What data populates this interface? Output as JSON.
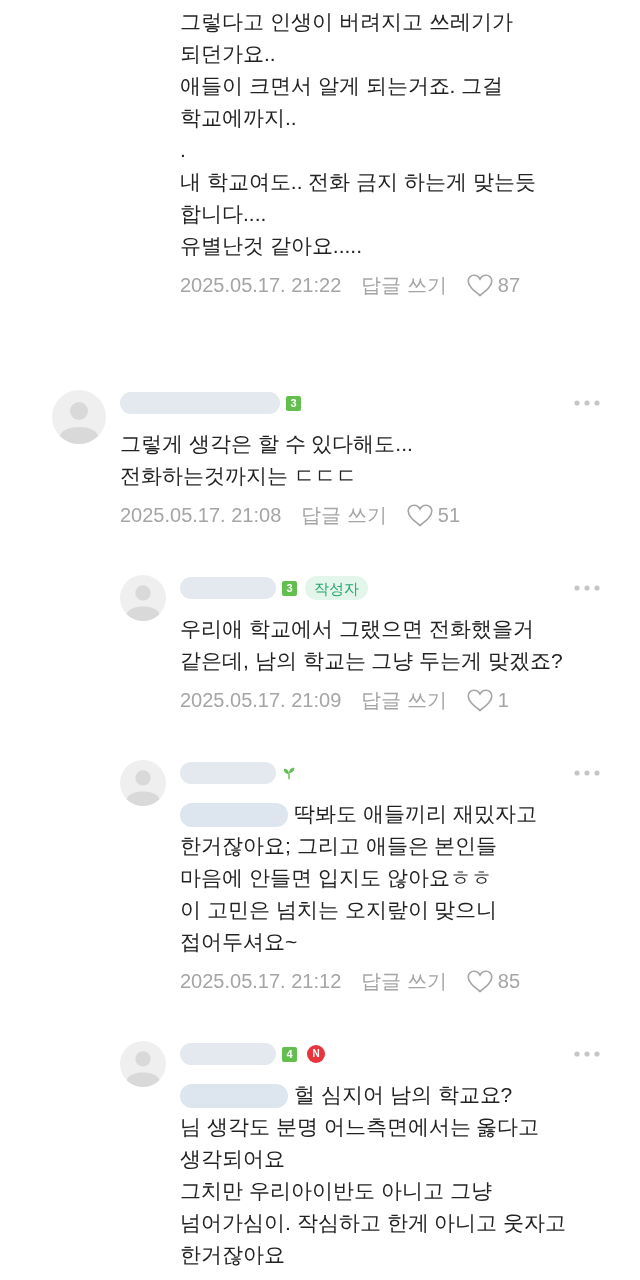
{
  "comments": [
    {
      "replies": [
        {
          "text": "그렇다고 인생이 버려지고 쓰레기가\n되던가요..\n애들이 크면서 알게 되는거죠. 그걸\n학교에까지..\n.\n내 학교여도.. 전화 금지 하는게 맞는듯\n합니다....\n유별난것 같아요.....",
          "date": "2025.05.17. 21:22",
          "reply_label": "답글 쓰기",
          "liked": false,
          "likes": "87"
        }
      ]
    },
    {
      "author": {
        "redacted": true
      },
      "badges": [
        {
          "kind": "level",
          "text": "3"
        }
      ],
      "text": "그렇게 생각은 할 수 있다해도...\n전화하는것까지는 ㄷㄷㄷ",
      "date": "2025.05.17. 21:08",
      "reply_label": "답글 쓰기",
      "liked": false,
      "likes": "51",
      "replies": [
        {
          "author": {
            "redacted": true
          },
          "badges": [
            {
              "kind": "level",
              "text": "3"
            },
            {
              "kind": "writer",
              "text": "작성자"
            }
          ],
          "text": "우리애 학교에서 그랬으면 전화했을거\n같은데, 남의 학교는 그냥 두는게 맞겠죠?",
          "date": "2025.05.17. 21:09",
          "reply_label": "답글 쓰기",
          "liked": false,
          "likes": "1"
        },
        {
          "author": {
            "redacted": true
          },
          "badges": [
            {
              "kind": "sprout"
            }
          ],
          "mention": {
            "redacted": true
          },
          "text": "딱봐도 애들끼리 재밌자고\n한거잖아요; 그리고 애들은 본인들\n마음에 안들면 입지도 않아요ㅎㅎ\n이 고민은 넘치는 오지랖이 맞으니\n접어두셔요~",
          "date": "2025.05.17. 21:12",
          "reply_label": "답글 쓰기",
          "liked": false,
          "likes": "85"
        },
        {
          "author": {
            "redacted": true
          },
          "badges": [
            {
              "kind": "level",
              "text": "4"
            },
            {
              "kind": "new",
              "text": "N"
            }
          ],
          "mention": {
            "redacted": true
          },
          "text": "헐 심지어 남의 학교요?\n님 생각도 분명 어느측면에서는 옳다고\n생각되어요\n그치만 우리아이반도 아니고 그냥\n넘어가심이. 작심하고 한게 아니고 웃자고\n한거잖아요"
        }
      ]
    }
  ]
}
